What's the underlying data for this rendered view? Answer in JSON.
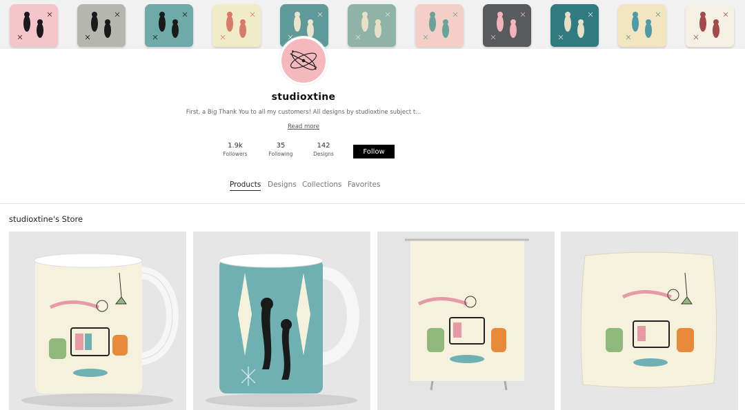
{
  "banner": {
    "pillows": [
      {
        "name": "pink-cats-pillow",
        "color": "#f4c6cc",
        "motif": "#1a1a1a"
      },
      {
        "name": "gray-cats-pillow",
        "color": "#b5b7ae",
        "motif": "#1a1a1a"
      },
      {
        "name": "teal-cats-pillow",
        "color": "#6eaaa8",
        "motif": "#1a1a1a"
      },
      {
        "name": "cream-abstract-pillow",
        "color": "#f0ecc8",
        "motif": "#d97a6a"
      },
      {
        "name": "teal-lamp-pillow",
        "color": "#5d9a99",
        "motif": "#eae4cf"
      },
      {
        "name": "mushroom-pattern-pillow",
        "color": "#8fb3a6",
        "motif": "#e7e0c4"
      },
      {
        "name": "pink-pattern-pillow",
        "color": "#f3cfc7",
        "motif": "#6aa39a"
      },
      {
        "name": "dark-gray-boomerang-pillow",
        "color": "#595a5c",
        "motif": "#f2b3bb"
      },
      {
        "name": "dark-teal-rocket-pillow",
        "color": "#2f7b80",
        "motif": "#e7e0c4"
      },
      {
        "name": "retro-shapes-pillow",
        "color": "#f3e5c0",
        "motif": "#4e9aa5"
      },
      {
        "name": "white-bug-pillow",
        "color": "#f4f0e4",
        "motif": "#a44a4a"
      }
    ]
  },
  "profile": {
    "username": "studioxtine",
    "bio": "First, a Big Thank You to all my customers! All designs by studioxtine subject t...",
    "read_more": "Read more",
    "stats": [
      {
        "value": "1.9k",
        "label": "Followers"
      },
      {
        "value": "35",
        "label": "Following"
      },
      {
        "value": "142",
        "label": "Designs"
      }
    ],
    "follow_label": "Follow"
  },
  "tabs": [
    {
      "label": "Products",
      "active": true
    },
    {
      "label": "Designs",
      "active": false
    },
    {
      "label": "Collections",
      "active": false
    },
    {
      "label": "Favorites",
      "active": false
    }
  ],
  "store": {
    "title": "studioxtine's Store",
    "products": [
      {
        "name": "retro-lounge-mug"
      },
      {
        "name": "teal-atomic-cats-mug"
      },
      {
        "name": "retro-lounge-shower-curtain"
      },
      {
        "name": "retro-lounge-throw-pillow"
      }
    ]
  },
  "colors": {
    "avatar_bg": "#f4b8bd",
    "follow_bg": "#000000",
    "cream": "#f6f1dc",
    "teal": "#6fb0b3"
  }
}
